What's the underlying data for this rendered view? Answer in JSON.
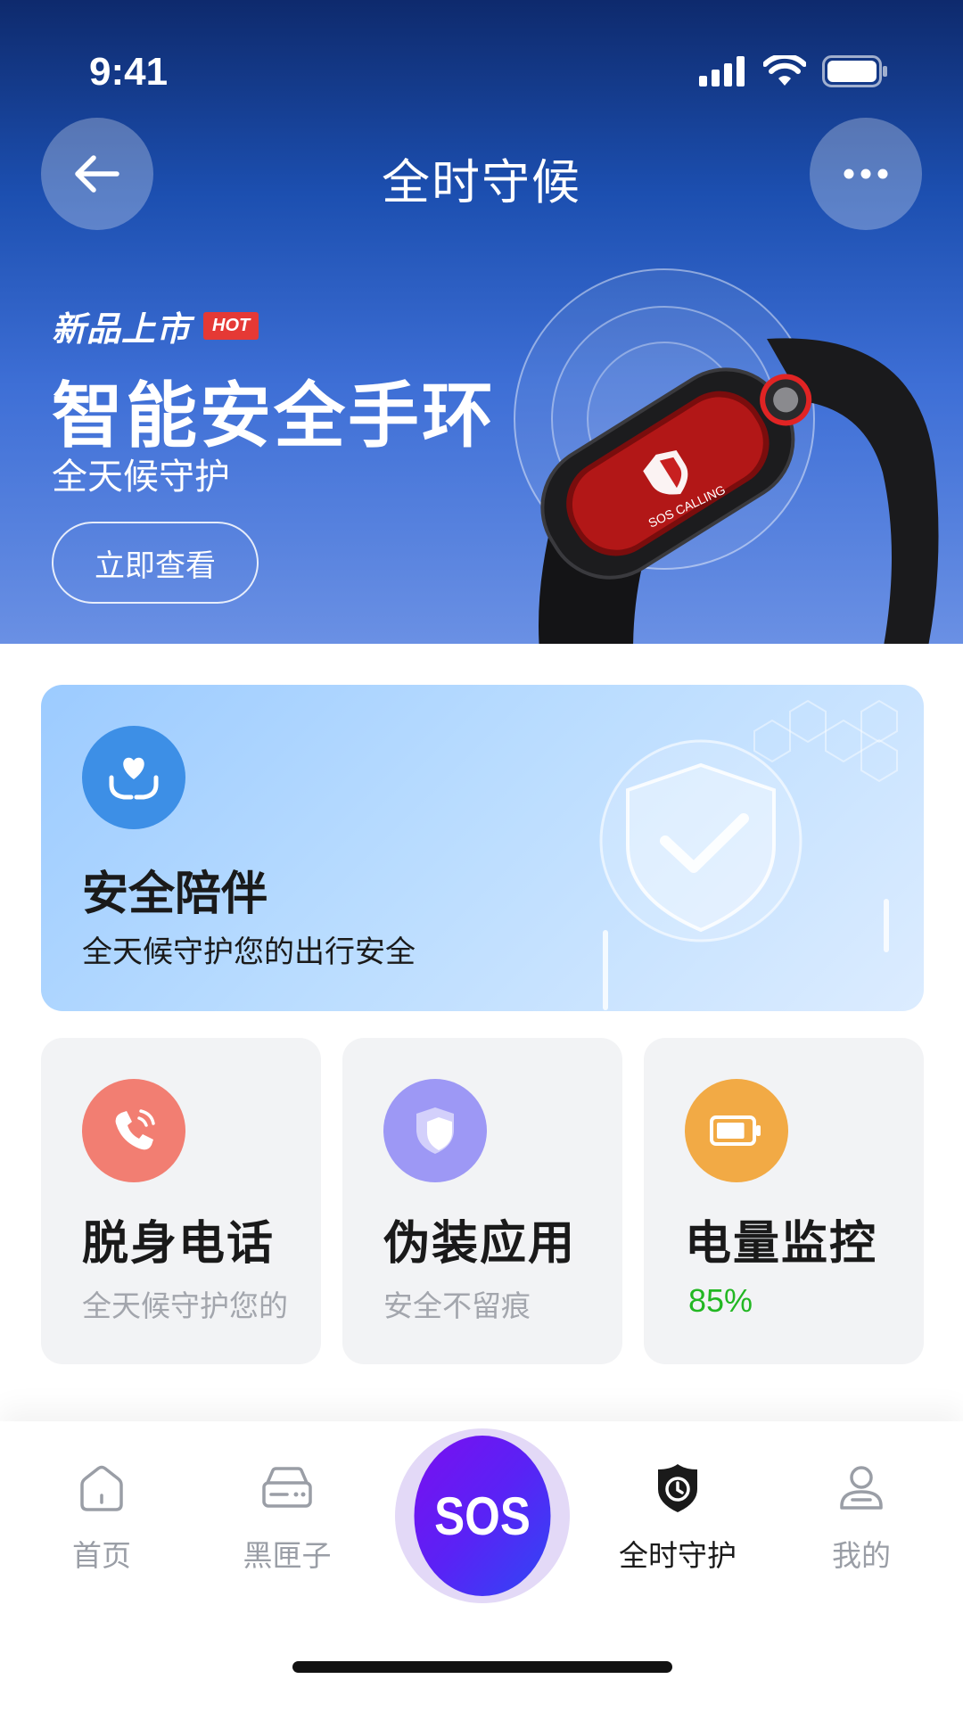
{
  "status_bar": {
    "time": "9:41"
  },
  "nav": {
    "title": "全时守候"
  },
  "banner": {
    "new_label": "新品上市",
    "hot_tag": "HOT",
    "title": "智能安全手环",
    "subtitle": "全天候守护",
    "cta": "立即查看",
    "device_screen_text": "SOS CALLING"
  },
  "safety_card": {
    "title": "安全陪伴",
    "description": "全天候守护您的出行安全",
    "icon": "heart-hands-icon"
  },
  "features": [
    {
      "title": "脱身电话",
      "subtitle": "全天候守护您的",
      "icon": "phone-icon",
      "icon_color": "#f27e72"
    },
    {
      "title": "伪装应用",
      "subtitle": "安全不留痕",
      "icon": "shield-icon",
      "icon_color": "#9d98f5"
    },
    {
      "title": "电量监控",
      "value": "85%",
      "icon": "battery-icon",
      "icon_color": "#f2aa45",
      "battery_level": 0.85
    }
  ],
  "tabbar": {
    "items": [
      {
        "label": "首页",
        "icon": "home-icon",
        "active": false
      },
      {
        "label": "黑匣子",
        "icon": "blackbox-icon",
        "active": false
      },
      {
        "label": "SOS",
        "icon": "sos-button",
        "active": false
      },
      {
        "label": "全时守护",
        "icon": "shield-clock-icon",
        "active": true
      },
      {
        "label": "我的",
        "icon": "profile-icon",
        "active": false
      }
    ]
  },
  "colors": {
    "hero_top": "#0e2a6d",
    "hero_bottom": "#6a90e4",
    "sos_gradient_start": "#7a0ff0",
    "sos_gradient_end": "#2f48f5",
    "battery_text": "#22b722"
  }
}
